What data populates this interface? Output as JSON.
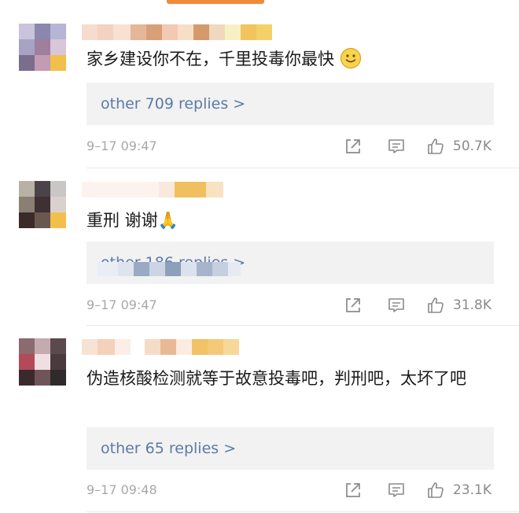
{
  "comments": [
    {
      "text": "家乡建设你不在，千里投毒你最快",
      "replies_label": "other 709 replies >",
      "time": "9–17 09:47",
      "likes": "50.7K",
      "emoji": "slightly-smiling-face-icon"
    },
    {
      "text": "重刑 谢谢🙏",
      "replies_label": "other 186 replies >",
      "time": "9–17 09:47",
      "likes": "31.8K",
      "emoji": "folded-hands-icon"
    },
    {
      "text": "伪造核酸检测就等于故意投毒吧，判刑吧，太坏了吧",
      "replies_label": "other 65 replies >",
      "time": "9–17 09:48",
      "likes": "23.1K"
    }
  ],
  "icons": {
    "share": "share-icon",
    "comment": "comment-icon",
    "like": "thumbs-up-icon"
  },
  "colors": {
    "accent": "#f08b3a",
    "link": "#5b7ba6",
    "reply_bg": "#f2f2f2",
    "meta": "#a8a8a8"
  }
}
